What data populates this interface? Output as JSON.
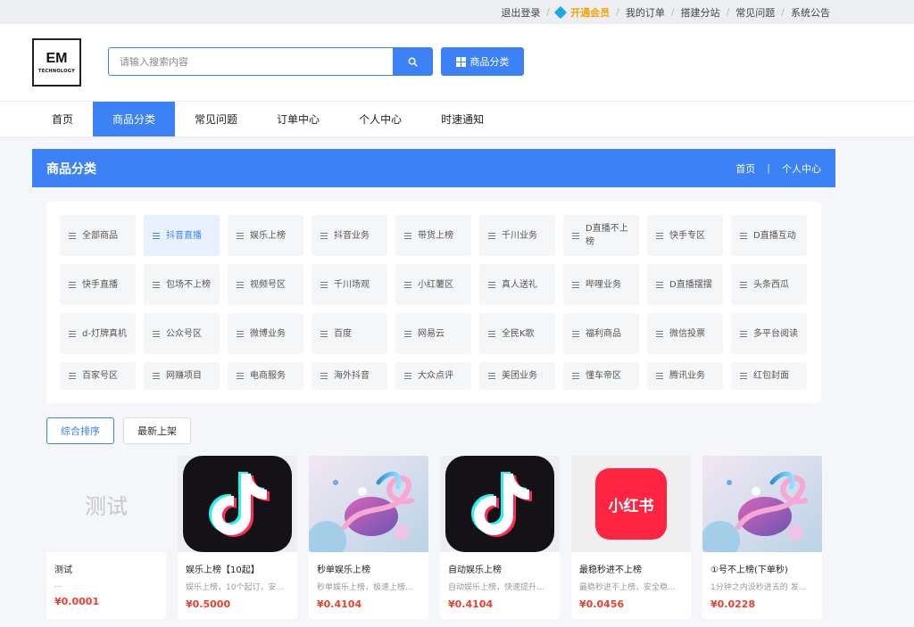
{
  "topbar": {
    "logout": "退出登录",
    "vip": "开通会员",
    "orders": "我的订单",
    "substation": "搭建分站",
    "faq": "常见问题",
    "notice": "系统公告"
  },
  "logo": {
    "main": "EM",
    "sub": "TECHNOLOGY"
  },
  "search": {
    "placeholder": "请输入搜索内容"
  },
  "category_button": "商品分类",
  "nav": [
    "首页",
    "商品分类",
    "常见问题",
    "订单中心",
    "个人中心",
    "时速通知"
  ],
  "banner": {
    "title": "商品分类",
    "crumb_home": "首页",
    "crumb_sep": "|",
    "crumb_user": "个人中心"
  },
  "categories": [
    "全部商品",
    "抖音直播",
    "娱乐上榜",
    "抖音业务",
    "带货上榜",
    "千川业务",
    "D直播不上榜",
    "快手专区",
    "D直播互动",
    "快手直播",
    "包场不上榜",
    "视频号区",
    "千川场观",
    "小红薯区",
    "真人送礼",
    "哔哩业务",
    "D直播摆摆",
    "头条西瓜",
    "d-灯牌真机",
    "公众号区",
    "微博业务",
    "百度",
    "网易云",
    "全民K歌",
    "福利商品",
    "微信投票",
    "多平台阅读",
    "百家号区",
    "网赚项目",
    "电商服务",
    "海外抖音",
    "大众点评",
    "美团业务",
    "懂车帝区",
    "腾讯业务",
    "红包封面"
  ],
  "active_category_index": 1,
  "sort": [
    "综合排序",
    "最新上架"
  ],
  "products": [
    {
      "name": "测试",
      "desc": "...",
      "price": "¥0.0001",
      "thumb": "test-text",
      "thumb_text": "测试"
    },
    {
      "name": "娱乐上榜【10起】",
      "desc": "娱乐上榜，10个起订，安...",
      "price": "¥0.5000",
      "thumb": "tiktok-logo"
    },
    {
      "name": "秒单娱乐上榜",
      "desc": "秒单娱乐上榜，极速上榜...",
      "price": "¥0.4104",
      "thumb": "abstract-art"
    },
    {
      "name": "自动娱乐上榜",
      "desc": "自动娱乐上榜，快速提升...",
      "price": "¥0.4104",
      "thumb": "tiktok-logo"
    },
    {
      "name": "最稳秒进不上榜",
      "desc": "最稳秒进不上榜，安全稳...",
      "price": "¥0.0456",
      "thumb": "xiaohongshu-logo",
      "thumb_text": "小红书"
    },
    {
      "name": "①号不上榜(下单秒)",
      "desc": "1分钟之内没秒进去的 发...",
      "price": "¥0.0228",
      "thumb": "abstract-art"
    }
  ],
  "colors": {
    "accent": "#3c82f6",
    "price": "#e8402f",
    "vip": "#f0a500"
  }
}
